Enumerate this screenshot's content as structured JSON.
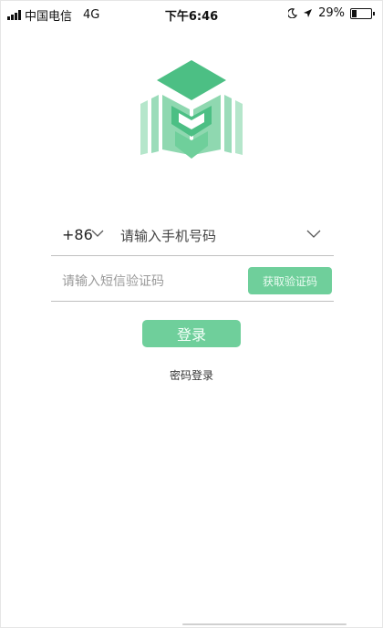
{
  "status_bar": {
    "carrier": "中国电信",
    "network": "4G",
    "time": "下午6:46",
    "battery_percent": "29%",
    "battery_level": 0.29,
    "icons": [
      "signal-icon",
      "moon-icon",
      "location-icon",
      "battery-icon"
    ]
  },
  "logo": {
    "icon": "graduation-book-logo",
    "colors": {
      "primary": "#4cbf84",
      "secondary": "#8fd8b0",
      "light": "#b5e6cb"
    }
  },
  "login_form": {
    "country_code": "+86",
    "phone_placeholder": "请输入手机号码",
    "code_placeholder": "请输入短信验证码",
    "get_code_label": "获取验证码",
    "login_label": "登录",
    "password_login_label": "密码登录"
  },
  "theme": {
    "accent": "#6fcf9b"
  }
}
